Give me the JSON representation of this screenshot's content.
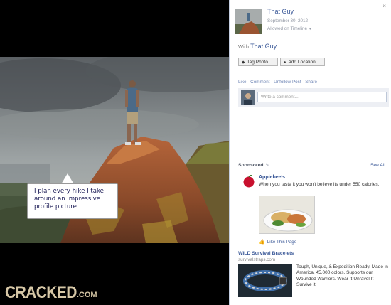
{
  "photo_caption": "I plan every hike I take around an impressive profile picture",
  "brand": {
    "name": "CRACKED",
    "suffix": ".COM"
  },
  "panel": {
    "close_icon": "×",
    "owner_name": "That Guy",
    "post_date": "September 30, 2012",
    "audience": "Allowed on Timeline",
    "audience_dropdown_icon": "▼",
    "with_label": "With",
    "with_name": "That Guy",
    "tag_photo_label": "Tag Photo",
    "add_location_label": "Add Location",
    "actions": {
      "like": "Like",
      "comment": "Comment",
      "unfollow": "Unfollow Post",
      "share": "Share",
      "separator": "·"
    },
    "comment_placeholder": "Write a comment...",
    "sponsored_label": "Sponsored",
    "see_all_label": "See All",
    "ad1": {
      "title": "Applebee's",
      "body": "When you taste it you won't believe its under 550 calories.",
      "like_label": "Like This Page"
    },
    "ad2": {
      "title": "WILD Survival Bracelets",
      "url": "survivalstraps.com",
      "body": "Tough, Unique, & Expedition Ready. Made in America. 45,000 colors. Supports our Wounded Warriors. Wear It-Unravel It-Survive it!"
    },
    "icons": {
      "tag": "tag-icon",
      "location": "map-pin-icon",
      "sponsored": "ad-info-icon",
      "like": "thumbs-up-icon",
      "close": "close-icon"
    }
  }
}
